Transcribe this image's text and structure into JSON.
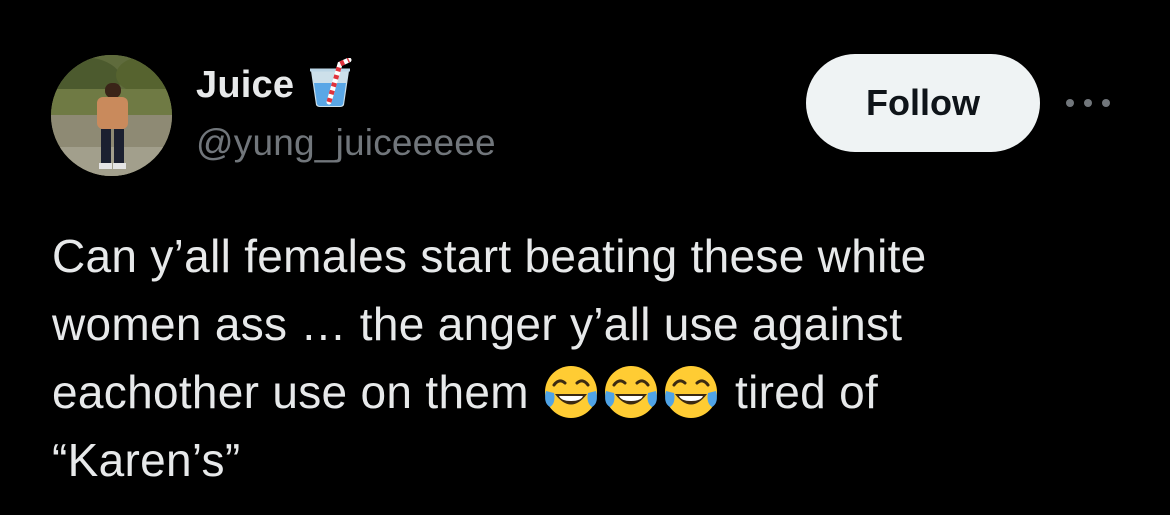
{
  "author": {
    "display_name": "Juice",
    "badge_icon": "glass-with-straw-icon",
    "handle": "@yung_juiceeeee"
  },
  "actions": {
    "follow_label": "Follow",
    "more_icon": "more-dots-icon"
  },
  "tweet": {
    "line1": "Can y’all females start beating these white",
    "line2": "women ass … the anger y’all use against",
    "line3_before": "eachother use on them ",
    "line3_emoji_icon": "face-with-tears-of-joy-icon",
    "line3_after": " tired of",
    "line4": "“Karen’s”"
  },
  "colors": {
    "background": "#000000",
    "text_primary": "#e7e9ea",
    "text_secondary": "#71767b",
    "follow_bg": "#eff3f4",
    "follow_text": "#0f1419"
  }
}
